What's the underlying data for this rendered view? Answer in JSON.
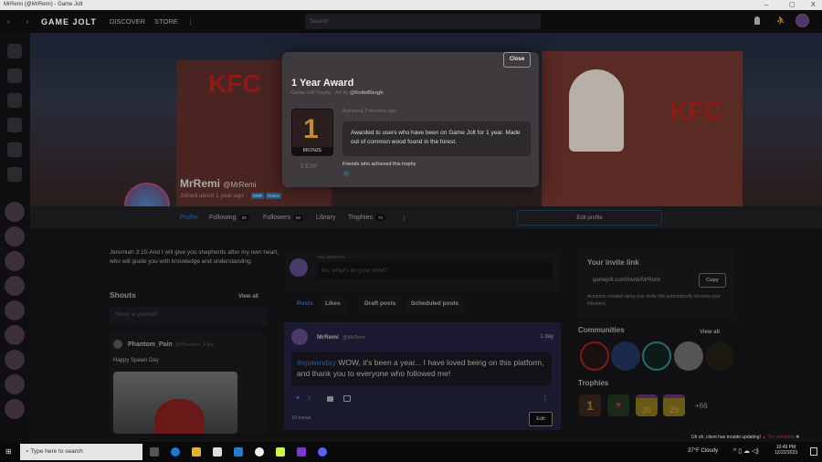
{
  "window": {
    "title": "MrRemi (@MrRemi) - Game Jolt",
    "minimize": "–",
    "maximize": "▢",
    "close": "X"
  },
  "nav": {
    "back": "‹",
    "forward": "›",
    "logo": "GAME JOLT",
    "discover": "DISCOVER",
    "store": "STORE",
    "more": "⋮",
    "search_placeholder": "Search"
  },
  "modal": {
    "close": "Close",
    "title": "1 Year Award",
    "type": "Game Jolt Trophy",
    "art_by_prefix": "Art by",
    "artist": "@KniteBlergh",
    "achieved": "Achieved 2 minutes ago",
    "description": "Awarded to users who have been on Game Jolt for 1 year. Made out of common wood found in the forest.",
    "tier": "BRONZE",
    "trophy_glyph": "1",
    "exp": "5 EXP",
    "friends_label": "Friends who achieved this trophy"
  },
  "profile": {
    "name": "MrRemi",
    "handle": "@MrRemi",
    "joined": "Joined about 1 year ago",
    "badges": [
      "GMR",
      "Online"
    ],
    "tabs": [
      {
        "label": "Profile"
      },
      {
        "label": "Following",
        "count": "29"
      },
      {
        "label": "Followers",
        "count": "58"
      },
      {
        "label": "Library"
      },
      {
        "label": "Trophies",
        "count": "70"
      }
    ],
    "more": "⋮",
    "edit": "Edit profile"
  },
  "bio": "Jeremiah 3:15-And I will give you shepherds after my own heart, who will guide you with knowledge and understanding.",
  "shouts": {
    "title": "Shouts",
    "view_all": "View all",
    "placeholder": "Shout at yourself!",
    "author": "Phantom_Pain",
    "author_handle": "@Phantom_Pain",
    "text": "Happy Spawn Day"
  },
  "composer": {
    "greeting": "Hey @MrRemi",
    "placeholder": "So, what's on your mind?"
  },
  "feed_tabs": [
    "Posts",
    "Likes",
    "Draft posts",
    "Scheduled posts"
  ],
  "post": {
    "author": "MrRemi",
    "handle": "@MrRemi",
    "age": "1 day",
    "hashtag": "#spawnday",
    "text": " WOW, it's been a year... I have loved being on this platform, and thank you to everyone who followed me!",
    "likes": "2",
    "views": "10 views",
    "edit": "Edit"
  },
  "invite": {
    "title": "Your invite link",
    "link": "gamejolt.com/invite/MrRemi",
    "copy": "Copy",
    "note": "Accounts created using your invite link automatically become your followers."
  },
  "communities": {
    "title": "Communities",
    "view_all": "View all"
  },
  "trophies": {
    "title": "Trophies",
    "more": "+66",
    "items": [
      "1",
      "♥",
      "30",
      "29"
    ]
  },
  "toast": {
    "text": "Uh oh, client has trouble updating!",
    "action": "Try restarting",
    "close": "✕"
  },
  "taskbar": {
    "search": "Type here to search",
    "weather": "37°F Cloudy",
    "time": "10:49 PM",
    "date": "12/22/2023"
  },
  "colors": {
    "accent": "#2a6ab0",
    "brand_red": "#8b1b17"
  }
}
